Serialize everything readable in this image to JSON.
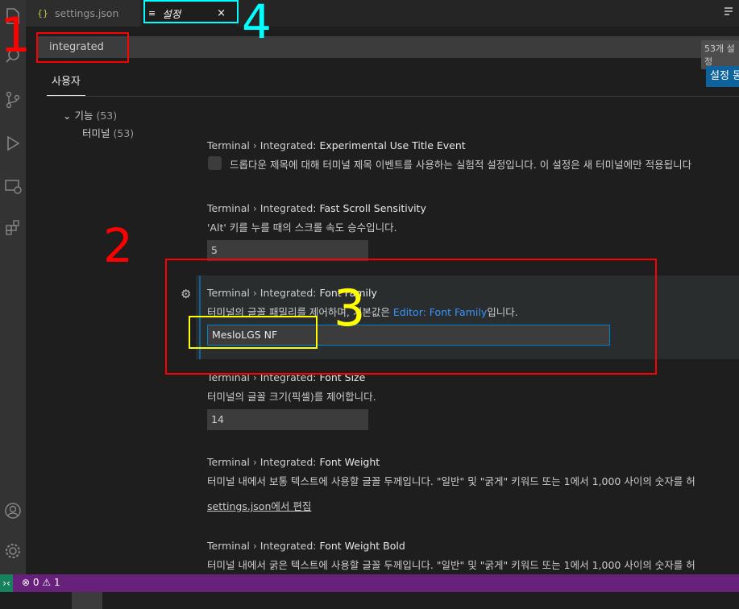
{
  "tabs": [
    {
      "label": "settings.json",
      "icon": "{}"
    },
    {
      "label": "설정",
      "icon": "≡",
      "close": "×"
    }
  ],
  "search": {
    "value": "integrated",
    "result_count": "53개 설정"
  },
  "scope": {
    "user_tab": "사용자",
    "sync_button": "설정 동"
  },
  "toc": {
    "features": "기능",
    "features_count": "(53)",
    "terminal": "터미널",
    "terminal_count": "(53)"
  },
  "settings": [
    {
      "category": "Terminal",
      "sep": "›",
      "group": "Integrated:",
      "name": "Experimental Use Title Event",
      "description": "드롭다운 제목에 대해 터미널 제목 이벤트를 사용하는 실험적 설정입니다. 이 설정은 새 터미널에만 적용됩니다"
    },
    {
      "category": "Terminal",
      "sep": "›",
      "group": "Integrated:",
      "name": "Fast Scroll Sensitivity",
      "description": "'Alt' 키를 누를 때의 스크롤 속도 승수입니다.",
      "value": "5"
    },
    {
      "category": "Terminal",
      "sep": "›",
      "group": "Integrated:",
      "name": "Font Family",
      "description_pre": "터미널의 글꼴 패밀리를 제어하며, 기본값은 ",
      "description_link": "Editor: Font Family",
      "description_post": "입니다.",
      "value": "MesloLGS NF"
    },
    {
      "category": "Terminal",
      "sep": "›",
      "group": "Integrated:",
      "name": "Font Size",
      "description": "터미널의 글꼴 크기(픽셀)를 제어합니다.",
      "value": "14"
    },
    {
      "category": "Terminal",
      "sep": "›",
      "group": "Integrated:",
      "name": "Font Weight",
      "description": "터미널 내에서 보통 텍스트에 사용할 글꼴 두께입니다. \"일반\" 및 \"굵게\" 키워드 또는 1에서 1,000 사이의 숫자를 허",
      "link": "settings.json에서 편집"
    },
    {
      "category": "Terminal",
      "sep": "›",
      "group": "Integrated:",
      "name": "Font Weight Bold",
      "description": "터미널 내에서 굵은 텍스트에 사용할 글꼴 두께입니다. \"일반\" 및 \"굵게\" 키워드 또는 1에서 1,000 사이의 숫자를 허"
    }
  ],
  "status": {
    "errors": "0",
    "warnings": "1"
  },
  "annotations": [
    "1",
    "2",
    "3",
    "4"
  ],
  "colors": {
    "accent": "#0e639c",
    "status_bar": "#68217a",
    "annotation_red": "#ff0000",
    "annotation_yellow": "#ffff00",
    "annotation_cyan": "#00ffff"
  },
  "icons": [
    "files-icon",
    "search-icon",
    "source-control-icon",
    "run-debug-icon",
    "remote-explorer-icon",
    "extensions-icon",
    "account-icon",
    "manage-gear-icon"
  ]
}
